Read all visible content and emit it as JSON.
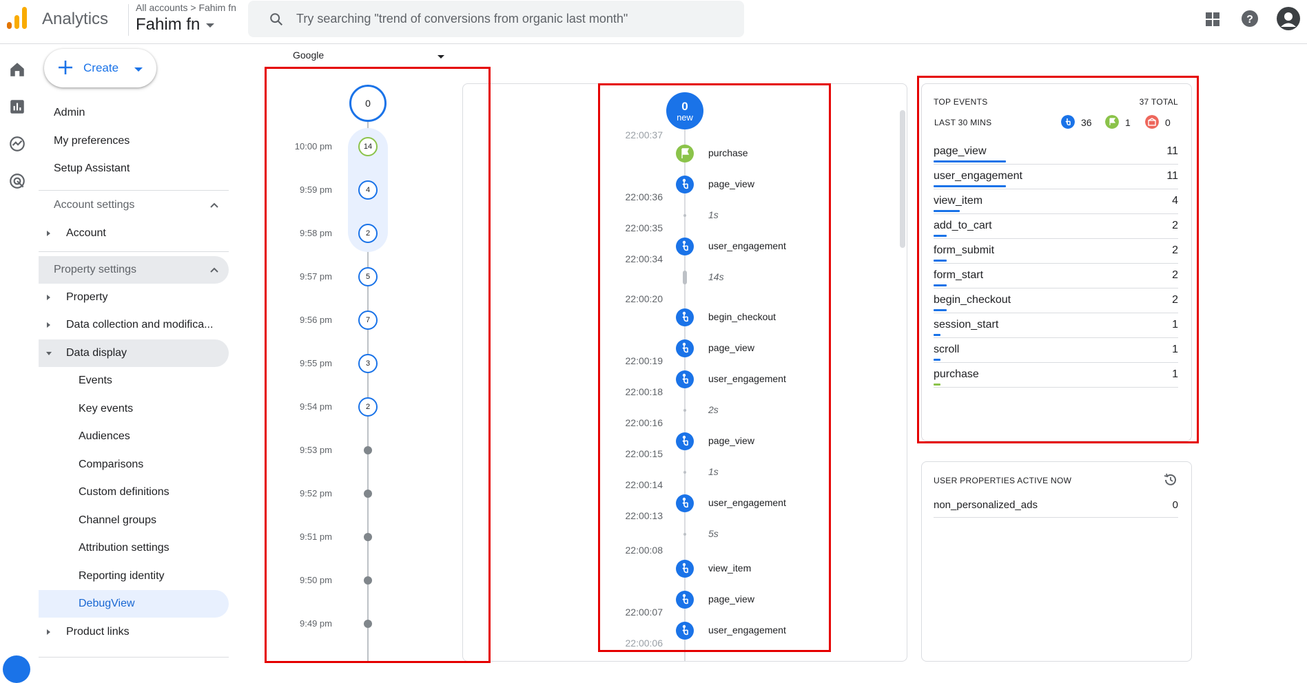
{
  "header": {
    "app_name": "Analytics",
    "breadcrumb": "All accounts > Fahim fn",
    "account": "Fahim fn",
    "search_placeholder": "Try searching \"trend of conversions from organic last month\""
  },
  "sidebar": {
    "create_label": "Create",
    "items": [
      {
        "label": "Admin"
      },
      {
        "label": "My preferences"
      },
      {
        "label": "Setup Assistant"
      },
      {
        "label": "Account settings"
      },
      {
        "label": "Account"
      },
      {
        "label": "Property settings"
      },
      {
        "label": "Property"
      },
      {
        "label": "Data collection and modifica..."
      },
      {
        "label": "Data display"
      },
      {
        "label": "Events"
      },
      {
        "label": "Key events"
      },
      {
        "label": "Audiences"
      },
      {
        "label": "Comparisons"
      },
      {
        "label": "Custom definitions"
      },
      {
        "label": "Channel groups"
      },
      {
        "label": "Attribution settings"
      },
      {
        "label": "Reporting identity"
      },
      {
        "label": "DebugView"
      },
      {
        "label": "Product links"
      }
    ]
  },
  "device_selector": "Google",
  "minutes": {
    "top_count": "0",
    "rows": [
      {
        "time": "10:00 pm",
        "count": "14"
      },
      {
        "time": "9:59 pm",
        "count": "4"
      },
      {
        "time": "9:58 pm",
        "count": "2"
      },
      {
        "time": "9:57 pm",
        "count": "5"
      },
      {
        "time": "9:56 pm",
        "count": "7"
      },
      {
        "time": "9:55 pm",
        "count": "3"
      },
      {
        "time": "9:54 pm",
        "count": "2"
      },
      {
        "time": "9:53 pm",
        "count": ""
      },
      {
        "time": "9:52 pm",
        "count": ""
      },
      {
        "time": "9:51 pm",
        "count": ""
      },
      {
        "time": "9:50 pm",
        "count": ""
      },
      {
        "time": "9:49 pm",
        "count": ""
      }
    ]
  },
  "seconds": {
    "new_count": "0",
    "new_label": "new",
    "times": [
      "22:00:37",
      "22:00:36",
      "22:00:35",
      "22:00:34",
      "22:00:20",
      "22:00:19",
      "22:00:18",
      "22:00:16",
      "22:00:15",
      "22:00:14",
      "22:00:13",
      "22:00:08",
      "22:00:07",
      "22:00:06"
    ],
    "events": [
      {
        "name": "purchase",
        "type": "key-event"
      },
      {
        "name": "page_view",
        "type": "event"
      },
      {
        "name": "user_engagement",
        "type": "event"
      },
      {
        "name": "begin_checkout",
        "type": "event"
      },
      {
        "name": "page_view",
        "type": "event"
      },
      {
        "name": "user_engagement",
        "type": "event"
      },
      {
        "name": "page_view",
        "type": "event"
      },
      {
        "name": "user_engagement",
        "type": "event"
      },
      {
        "name": "view_item",
        "type": "event"
      },
      {
        "name": "page_view",
        "type": "event"
      },
      {
        "name": "user_engagement",
        "type": "event"
      }
    ],
    "gaps": [
      "1s",
      "14s",
      "2s",
      "1s",
      "5s"
    ]
  },
  "top_events": {
    "title": "TOP EVENTS",
    "total": "37 TOTAL",
    "subtitle": "LAST 30 MINS",
    "counts": {
      "events": "36",
      "key_events": "1",
      "errors": "0"
    },
    "rows": [
      {
        "name": "page_view",
        "value": 11
      },
      {
        "name": "user_engagement",
        "value": 11
      },
      {
        "name": "view_item",
        "value": 4
      },
      {
        "name": "add_to_cart",
        "value": 2
      },
      {
        "name": "form_submit",
        "value": 2
      },
      {
        "name": "form_start",
        "value": 2
      },
      {
        "name": "begin_checkout",
        "value": 2
      },
      {
        "name": "session_start",
        "value": 1
      },
      {
        "name": "scroll",
        "value": 1
      },
      {
        "name": "purchase",
        "value": 1,
        "bar_color": "#8bc34a"
      }
    ]
  },
  "user_properties": {
    "title": "USER PROPERTIES ACTIVE NOW",
    "rows": [
      {
        "name": "non_personalized_ads",
        "value": "0"
      }
    ]
  },
  "colors": {
    "accent": "#1a73e8",
    "key_event": "#8bc34a",
    "error": "#ee675c",
    "highlight": "#e50000"
  }
}
